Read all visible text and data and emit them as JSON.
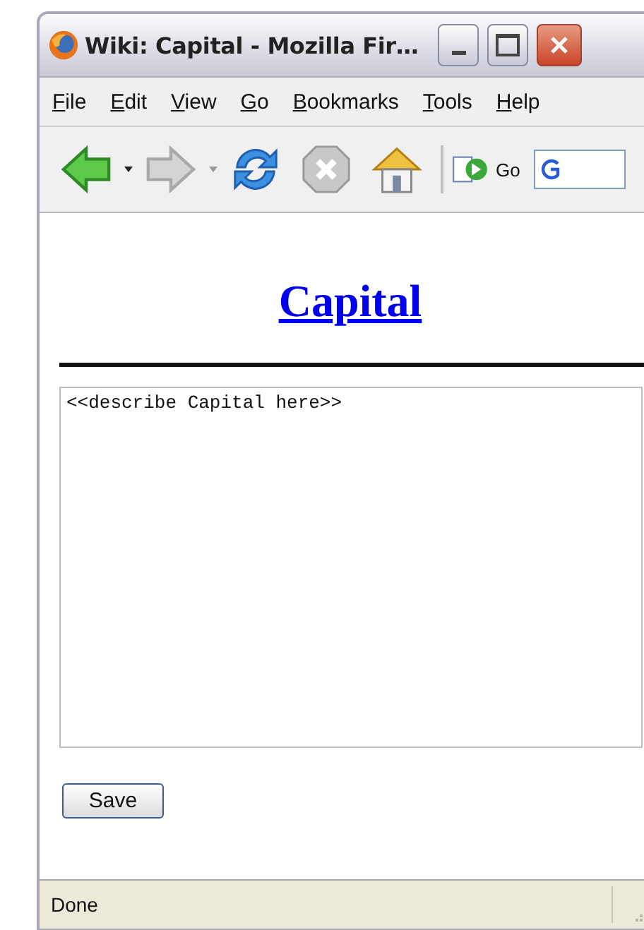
{
  "window": {
    "title": "Wiki: Capital - Mozilla Fir…"
  },
  "menu": [
    "File",
    "Edit",
    "View",
    "Go",
    "Bookmarks",
    "Tools",
    "Help"
  ],
  "toolbar": {
    "back_disabled": false,
    "forward_disabled": true,
    "stop_disabled": true,
    "go_label": "Go"
  },
  "page": {
    "heading": "Capital",
    "editor_value": "<<describe Capital here>>",
    "save_label": "Save"
  },
  "status_bar": {
    "text": "Done"
  }
}
